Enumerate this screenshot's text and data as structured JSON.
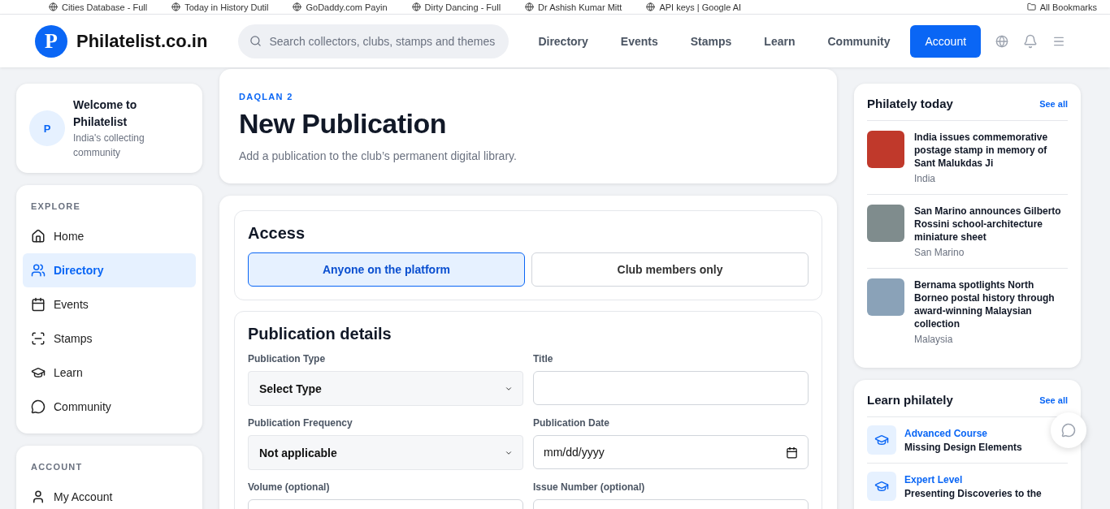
{
  "bookmarks": [
    "Cities Database - Full",
    "Today in History Dutil",
    "GoDaddy.com Payin",
    "Dirty Dancing - Full",
    "Dr Ashish Kumar Mitt",
    "API keys | Google AI",
    "All Bookmarks"
  ],
  "header": {
    "logo_letter": "P",
    "site_name": "Philatelist.co.in",
    "search": {
      "placeholder": "Search collectors, clubs, stamps and themes"
    },
    "nav": [
      "Directory",
      "Events",
      "Stamps",
      "Learn",
      "Community"
    ],
    "account_button": "Account"
  },
  "welcome": {
    "avatar_letter": "P",
    "title": "Welcome to Philatelist",
    "subtitle": "India's collecting community"
  },
  "explore": {
    "heading": "EXPLORE",
    "items": [
      {
        "label": "Home",
        "kind": "home",
        "selected": false
      },
      {
        "label": "Directory",
        "kind": "users",
        "selected": true
      },
      {
        "label": "Events",
        "kind": "calendar",
        "selected": false
      },
      {
        "label": "Stamps",
        "kind": "stamp",
        "selected": false
      },
      {
        "label": "Learn",
        "kind": "cap",
        "selected": false
      },
      {
        "label": "Community",
        "kind": "chat",
        "selected": false
      }
    ]
  },
  "account": {
    "heading": "ACCOUNT",
    "items": [
      {
        "label": "My Account",
        "kind": "user",
        "selected": false
      }
    ]
  },
  "page": {
    "eyebrow": "DAQLAN 2",
    "title": "New Publication",
    "subtitle": "Add a publication to the club’s permanent digital library."
  },
  "access": {
    "heading": "Access",
    "options": [
      {
        "label": "Anyone on the platform",
        "selected": true
      },
      {
        "label": "Club members only",
        "selected": false
      }
    ]
  },
  "details": {
    "heading": "Publication details",
    "fields": [
      {
        "label": "Publication Type",
        "kind": "select",
        "value": "Select Type"
      },
      {
        "label": "Title",
        "kind": "text"
      },
      {
        "label": "Publication Frequency",
        "kind": "select",
        "value": "Not applicable"
      },
      {
        "label": "Publication Date",
        "kind": "date",
        "value": "mm/dd/yyyy"
      },
      {
        "label": "Volume (optional)",
        "kind": "text"
      },
      {
        "label": "Issue Number (optional)",
        "kind": "text"
      }
    ]
  },
  "news": {
    "heading": "Philately today",
    "see_all": "See all",
    "items": [
      {
        "title": "India issues commemorative postage stamp in memory of Sant Malukdas Ji",
        "country": "India",
        "color": "#c0392b"
      },
      {
        "title": "San Marino announces Gilberto Rossini school-architecture miniature sheet",
        "country": "San Marino",
        "color": "#7f8c8d"
      },
      {
        "title": "Bernama spotlights North Borneo postal history through award-winning Malaysian collection",
        "country": "Malaysia",
        "color": "#8aa2b8"
      }
    ]
  },
  "learn": {
    "heading": "Learn philately",
    "see_all": "See all",
    "items": [
      {
        "level": "Advanced Course",
        "title": "Missing Design Elements"
      },
      {
        "level": "Expert Level",
        "title": "Presenting Discoveries to the"
      }
    ]
  }
}
